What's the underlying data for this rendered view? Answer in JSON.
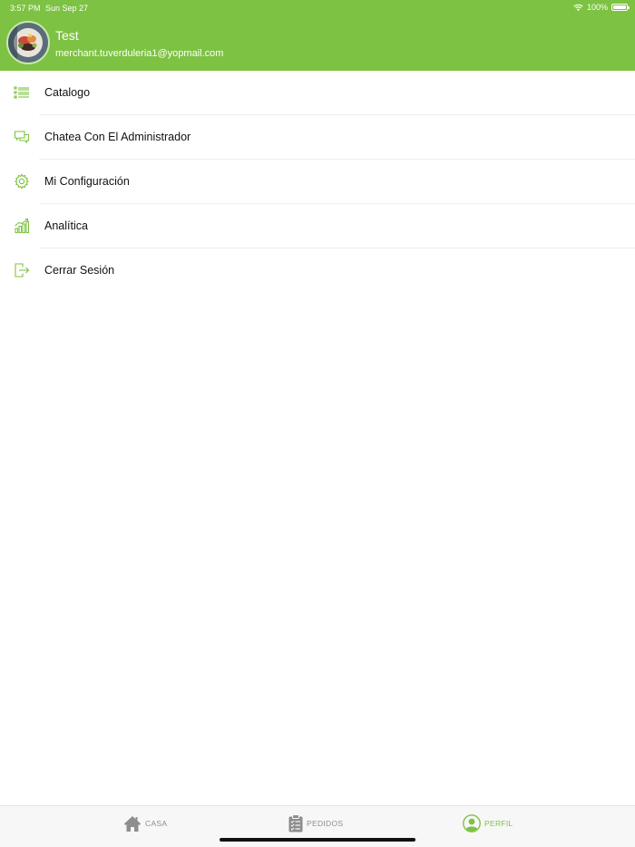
{
  "status_bar": {
    "time": "3:57 PM",
    "date": "Sun Sep 27",
    "battery": "100%",
    "wifi_icon": "wifi-icon",
    "battery_icon": "battery-icon"
  },
  "profile": {
    "name": "Test",
    "email": "merchant.tuverduleria1@yopmail.com"
  },
  "menu": {
    "items": [
      {
        "label": "Catalogo",
        "icon": "list-icon"
      },
      {
        "label": "Chatea Con El Administrador",
        "icon": "chat-icon"
      },
      {
        "label": "Mi Configuración",
        "icon": "gear-icon"
      },
      {
        "label": "Analítica",
        "icon": "analytics-icon"
      },
      {
        "label": "Cerrar Sesión",
        "icon": "logout-icon"
      }
    ]
  },
  "tabbar": {
    "tabs": [
      {
        "label": "CASA",
        "icon": "home-icon",
        "active": false
      },
      {
        "label": "PEDIDOS",
        "icon": "clipboard-icon",
        "active": false
      },
      {
        "label": "PERFIL",
        "icon": "user-icon",
        "active": true
      }
    ]
  },
  "colors": {
    "accent": "#7dc242",
    "tab_inactive": "#8e8e8e"
  }
}
